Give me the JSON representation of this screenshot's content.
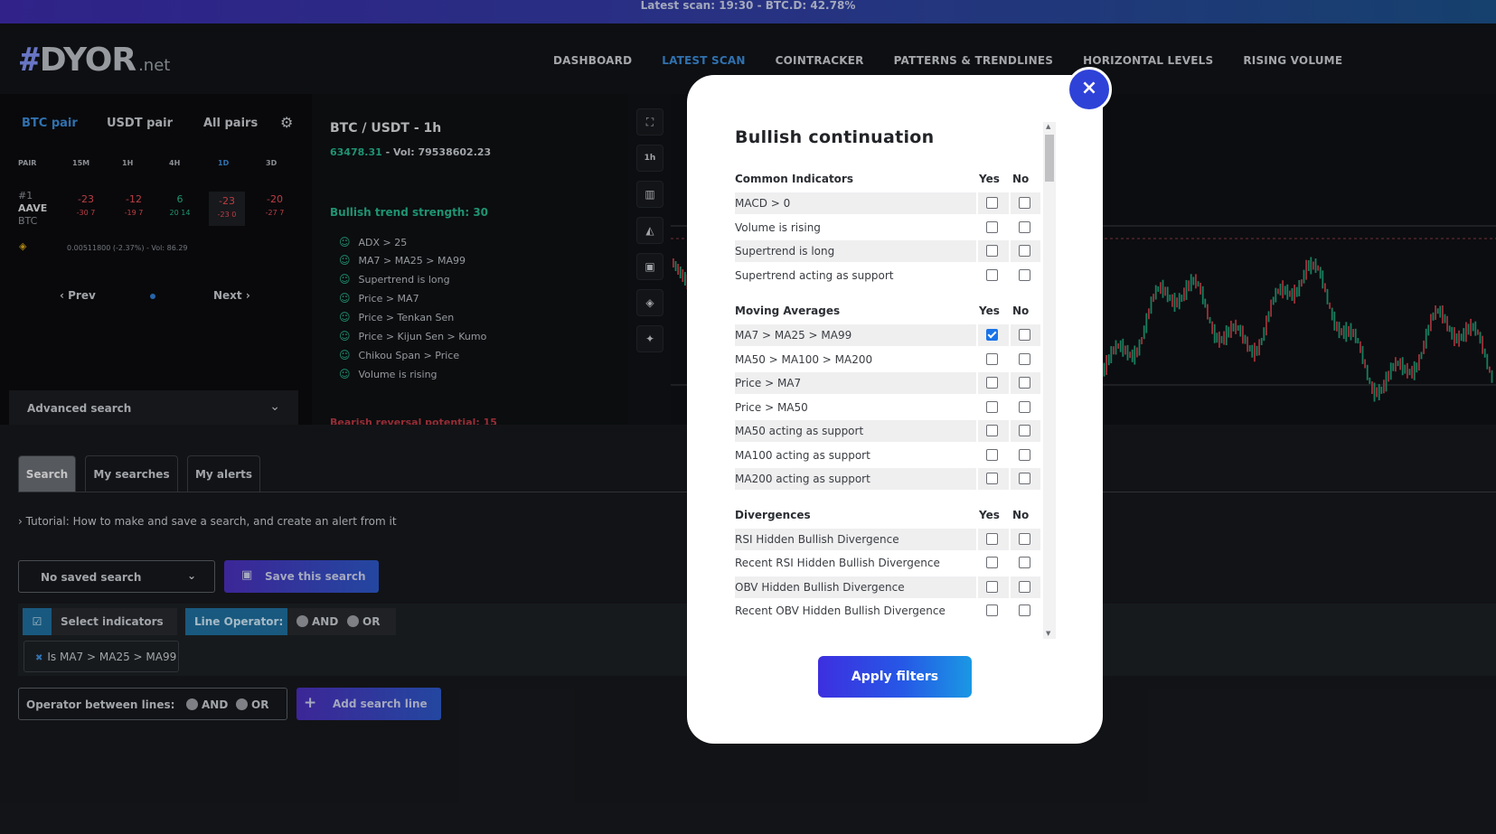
{
  "banner": {
    "text": "Latest scan: 19:30 - BTC.D: 42.78%"
  },
  "logo": {
    "hash": "#",
    "name": "DYOR",
    "tld": ".net"
  },
  "nav": {
    "items": [
      "DASHBOARD",
      "LATEST SCAN",
      "COINTRACKER",
      "PATTERNS & TRENDLINES",
      "HORIZONTAL LEVELS",
      "RISING VOLUME"
    ],
    "active_index": 1
  },
  "left_panel": {
    "pair_tabs": [
      "BTC pair",
      "USDT pair",
      "All pairs"
    ],
    "columns": [
      "PAIR",
      "15M",
      "1H",
      "4H",
      "1D",
      "3D"
    ],
    "coin": {
      "rank": "#1",
      "symbol": "AAVE",
      "quote": "BTC"
    },
    "values": [
      {
        "main": "-23",
        "sub": "-30 7"
      },
      {
        "main": "-12",
        "sub": "-19 7"
      },
      {
        "main": "6",
        "sub": "20 14"
      },
      {
        "main": "-23",
        "sub": "-23 0"
      },
      {
        "main": "-20",
        "sub": "-27 7"
      }
    ],
    "price_line": "0.00511800 (-2.37%) - Vol: 86.29",
    "prev": "Prev",
    "next": "Next",
    "advanced_search": "Advanced search"
  },
  "middle_panel": {
    "pair_title": "BTC / USDT - 1h",
    "price": "63478.31",
    "vol": " - Vol: 79538602.23",
    "trend_title": "Bullish trend strength: 30",
    "conditions": [
      "ADX > 25",
      "MA7 > MA25 > MA99",
      "Supertrend is long",
      "Price > MA7",
      "Price > Tenkan Sen",
      "Price > Kijun Sen > Kumo",
      "Chikou Span > Price",
      "Volume is rising"
    ],
    "bearish_title": "Bearish reversal potential: 15"
  },
  "toolbar": {
    "icons": [
      "fullscreen-icon",
      "timeframe-icon",
      "bar-chart-icon",
      "area-chart-icon",
      "save-icon",
      "binance-icon",
      "twitter-icon"
    ],
    "timeframe_label": "1h"
  },
  "lower": {
    "tabs": [
      "Search",
      "My searches",
      "My alerts"
    ],
    "tutorial": "Tutorial: How to make and save a search, and create an alert from it",
    "saved_select": "No saved search",
    "save_button": "Save this search",
    "select_indicators": "Select indicators",
    "line_operator": "Line Operator:",
    "op_and": "AND",
    "op_or": "OR",
    "chip": "Is MA7 > MA25 > MA99",
    "operator_between": "Operator between lines:",
    "add_line": "Add search line"
  },
  "modal": {
    "title": "Bullish continuation",
    "yes": "Yes",
    "no": "No",
    "sections": [
      {
        "name": "Common Indicators",
        "rows": [
          {
            "label": "MACD > 0",
            "yes": false,
            "no": false
          },
          {
            "label": "Volume is rising",
            "yes": false,
            "no": false
          },
          {
            "label": "Supertrend is long",
            "yes": false,
            "no": false
          },
          {
            "label": "Supertrend acting as support",
            "yes": false,
            "no": false
          }
        ]
      },
      {
        "name": "Moving Averages",
        "rows": [
          {
            "label": "MA7 > MA25 > MA99",
            "yes": true,
            "no": false
          },
          {
            "label": "MA50 > MA100 > MA200",
            "yes": false,
            "no": false
          },
          {
            "label": "Price > MA7",
            "yes": false,
            "no": false
          },
          {
            "label": "Price > MA50",
            "yes": false,
            "no": false
          },
          {
            "label": "MA50 acting as support",
            "yes": false,
            "no": false
          },
          {
            "label": "MA100 acting as support",
            "yes": false,
            "no": false
          },
          {
            "label": "MA200 acting as support",
            "yes": false,
            "no": false
          }
        ]
      },
      {
        "name": "Divergences",
        "rows": [
          {
            "label": "RSI Hidden Bullish Divergence",
            "yes": false,
            "no": false
          },
          {
            "label": "Recent RSI Hidden Bullish Divergence",
            "yes": false,
            "no": false
          },
          {
            "label": "OBV Hidden Bullish Divergence",
            "yes": false,
            "no": false
          },
          {
            "label": "Recent OBV Hidden Bullish Divergence",
            "yes": false,
            "no": false
          }
        ]
      }
    ],
    "apply": "Apply filters",
    "close": "×"
  },
  "colors": {
    "accent": "#2e42d8",
    "green": "#27b48a",
    "red": "#e44b55",
    "link": "#3b8ad6"
  }
}
